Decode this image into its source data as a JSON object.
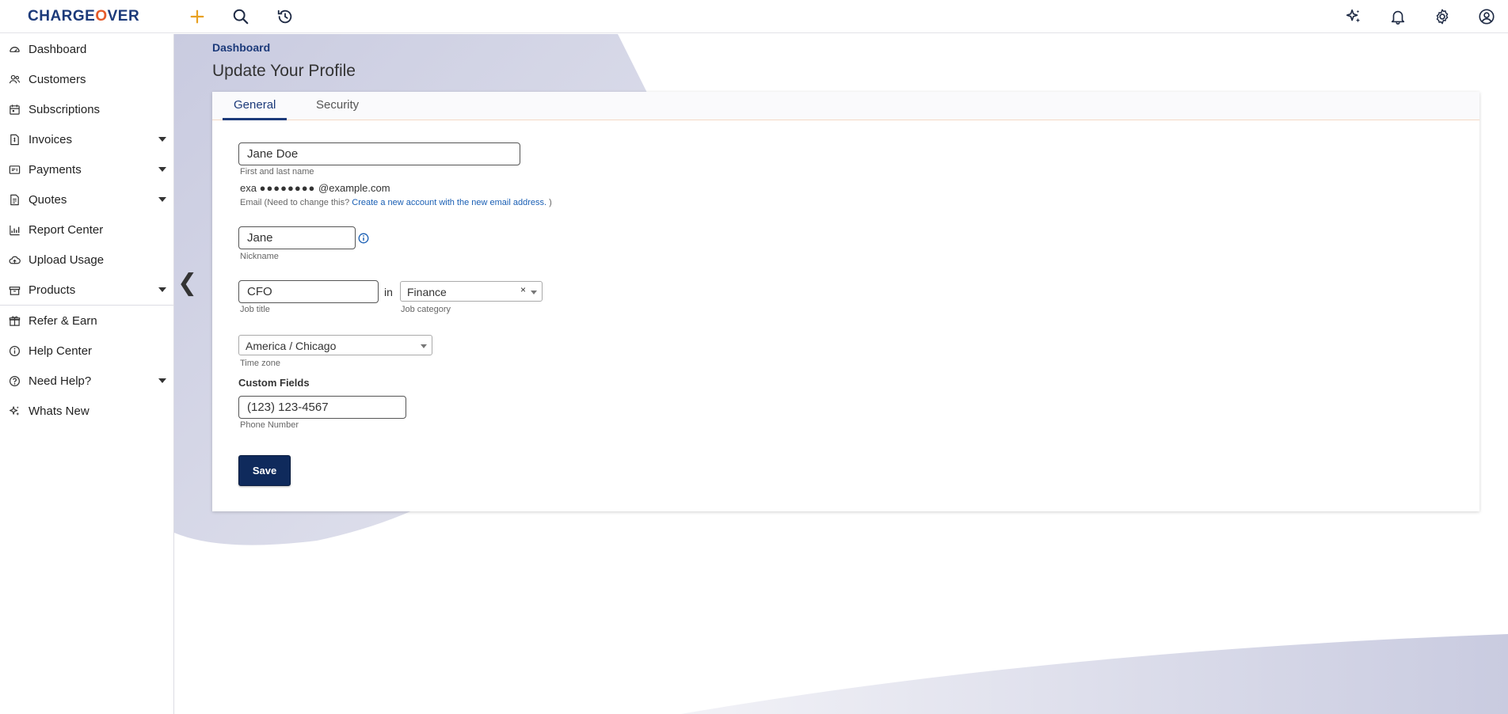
{
  "app": {
    "logo_text_1": "CHARGE",
    "logo_text_accent": "O",
    "logo_text_2": "VER",
    "brand_color": "#1c3a7a",
    "accent_color": "#e55a2a"
  },
  "topbar": {
    "left_icons": [
      "plus-icon",
      "search-icon",
      "history-icon"
    ],
    "right_icons": [
      "sparkle-icon",
      "bell-icon",
      "gear-icon",
      "user-circle-icon"
    ]
  },
  "sidebar": {
    "items": [
      {
        "label": "Dashboard",
        "icon": "dashboard-icon",
        "has_caret": false
      },
      {
        "label": "Customers",
        "icon": "users-icon",
        "has_caret": false
      },
      {
        "label": "Subscriptions",
        "icon": "calendar-icon",
        "has_caret": false
      },
      {
        "label": "Invoices",
        "icon": "invoice-icon",
        "has_caret": true
      },
      {
        "label": "Payments",
        "icon": "payment-card-icon",
        "has_caret": true
      },
      {
        "label": "Quotes",
        "icon": "document-icon",
        "has_caret": true
      },
      {
        "label": "Report Center",
        "icon": "chart-icon",
        "has_caret": false
      },
      {
        "label": "Upload Usage",
        "icon": "upload-icon",
        "has_caret": false
      },
      {
        "label": "Products",
        "icon": "box-icon",
        "has_caret": true
      }
    ],
    "secondary_items": [
      {
        "label": "Refer & Earn",
        "icon": "gift-icon",
        "has_caret": false
      },
      {
        "label": "Help Center",
        "icon": "info-circle-icon",
        "has_caret": false
      },
      {
        "label": "Need Help?",
        "icon": "question-circle-icon",
        "has_caret": true
      },
      {
        "label": "Whats New",
        "icon": "sparkle-icon",
        "has_caret": false
      }
    ],
    "collapse_glyph": "❮"
  },
  "header": {
    "breadcrumb": "Dashboard",
    "title": "Update Your Profile"
  },
  "tabs": [
    {
      "label": "General",
      "active": true
    },
    {
      "label": "Security",
      "active": false
    }
  ],
  "form": {
    "full_name": {
      "value": "Jane Doe",
      "help": "First and last name"
    },
    "email": {
      "prefix": "exa",
      "masked": "●●●●●●●●",
      "domain": "@example.com",
      "note_prefix": "Email (Need to change this? ",
      "note_link": "Create a new account with the new email address.",
      "note_suffix": " )"
    },
    "nickname": {
      "value": "Jane",
      "help": "Nickname"
    },
    "job_title": {
      "value": "CFO",
      "help": "Job title"
    },
    "in_word": "in",
    "job_category": {
      "value": "Finance",
      "help": "Job category",
      "clear_glyph": "×"
    },
    "time_zone": {
      "value": "America / Chicago",
      "help": "Time zone"
    },
    "custom_fields_label": "Custom Fields",
    "phone": {
      "value": "(123) 123-4567",
      "help": "Phone Number"
    },
    "save_label": "Save"
  }
}
